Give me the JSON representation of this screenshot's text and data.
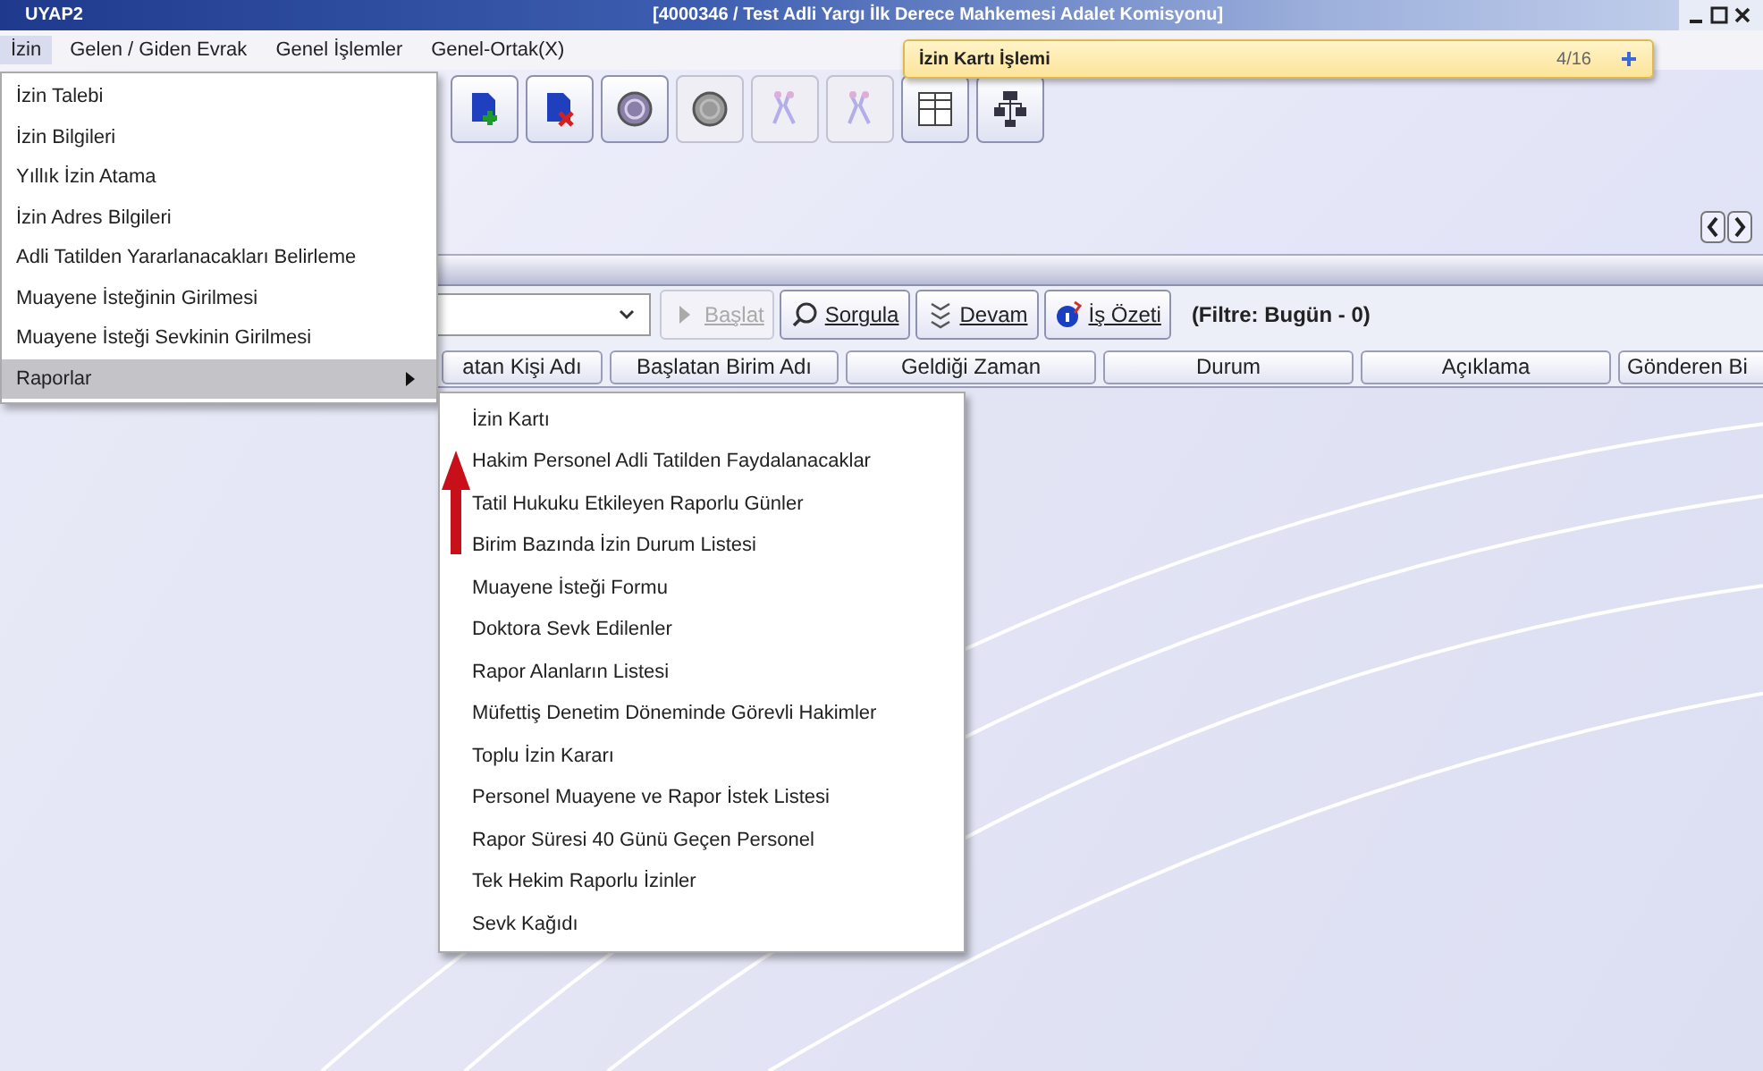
{
  "window": {
    "app": "UYAP2",
    "title": "[4000346 / Test Adli Yargı İlk Derece Mahkemesi Adalet Komisyonu]"
  },
  "menubar": [
    {
      "label": "İzin",
      "selected": true
    },
    {
      "label": "Gelen / Giden Evrak",
      "selected": false
    },
    {
      "label": "Genel İşlemler",
      "selected": false
    },
    {
      "label": "Genel-Ortak(X)",
      "selected": false
    }
  ],
  "notification": {
    "title": "İzin Kartı İşlemi",
    "counter": "4/16"
  },
  "toolbar": [
    {
      "kind": "doc-add",
      "disabled": false
    },
    {
      "kind": "doc-remove",
      "disabled": false
    },
    {
      "kind": "circle",
      "disabled": false
    },
    {
      "kind": "circle",
      "disabled": true
    },
    {
      "kind": "figures",
      "disabled": true
    },
    {
      "kind": "figures",
      "disabled": true
    },
    {
      "kind": "grid",
      "disabled": false
    },
    {
      "kind": "tree",
      "disabled": false
    }
  ],
  "filter_bar": {
    "buttons": [
      {
        "label": "Başlat",
        "kind": "start",
        "disabled": true
      },
      {
        "label": "Sorgula",
        "kind": "query",
        "disabled": false
      },
      {
        "label": "Devam",
        "kind": "continue",
        "disabled": false
      },
      {
        "label": "İş Özeti",
        "kind": "summary",
        "disabled": false
      }
    ],
    "filter": "(Filtre: Bugün - 0)"
  },
  "table": {
    "columns": [
      "atan Kişi Adı",
      "Başlatan Birim Adı",
      "Geldiği Zaman",
      "Durum",
      "Açıklama",
      "Gönderen Bi"
    ]
  },
  "menu": {
    "items": [
      {
        "label": "İzin Talebi",
        "selected": false,
        "submenu": false
      },
      {
        "label": "İzin Bilgileri",
        "selected": false,
        "submenu": false
      },
      {
        "label": "Yıllık İzin Atama",
        "selected": false,
        "submenu": false
      },
      {
        "label": "İzin Adres Bilgileri",
        "selected": false,
        "submenu": false
      },
      {
        "label": "Adli Tatilden Yararlanacakları Belirleme",
        "selected": false,
        "submenu": false
      },
      {
        "label": "Muayene İsteğinin Girilmesi",
        "selected": false,
        "submenu": false
      },
      {
        "label": "Muayene İsteği Sevkinin Girilmesi",
        "selected": false,
        "submenu": false
      },
      {
        "label": "Raporlar",
        "selected": true,
        "submenu": true
      }
    ]
  },
  "submenu": {
    "items": [
      {
        "label": "İzin Kartı",
        "selected": false
      },
      {
        "label": "Hakim Personel Adli Tatilden Faydalanacaklar",
        "selected": false
      },
      {
        "label": "Tatil Hukuku Etkileyen Raporlu Günler",
        "selected": false
      },
      {
        "label": "Birim Bazında İzin Durum Listesi",
        "selected": false
      },
      {
        "label": "Muayene İsteği Formu",
        "selected": false
      },
      {
        "label": "Doktora Sevk Edilenler",
        "selected": false
      },
      {
        "label": "Rapor Alanların Listesi",
        "selected": false
      },
      {
        "label": "Müfettiş Denetim Döneminde Görevli Hakimler",
        "selected": false
      },
      {
        "label": "Toplu İzin Kararı",
        "selected": false
      },
      {
        "label": "Personel Muayene ve Rapor İstek Listesi",
        "selected": false
      },
      {
        "label": "Rapor Süresi 40 Günü Geçen Personel",
        "selected": false
      },
      {
        "label": "Tek Hekim Raporlu İzinler",
        "selected": false
      },
      {
        "label": "Sevk Kağıdı",
        "selected": false
      }
    ]
  }
}
